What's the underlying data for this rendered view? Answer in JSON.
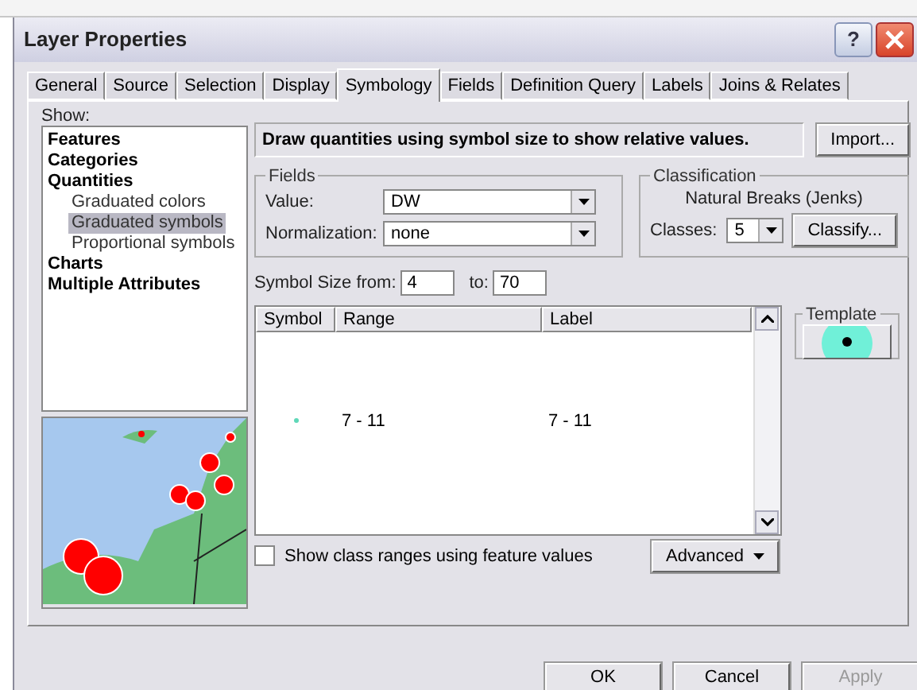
{
  "window": {
    "title": "Layer Properties",
    "help": "?"
  },
  "tabs": [
    {
      "label": "General",
      "selected": false
    },
    {
      "label": "Source",
      "selected": false
    },
    {
      "label": "Selection",
      "selected": false
    },
    {
      "label": "Display",
      "selected": false
    },
    {
      "label": "Symbology",
      "selected": true
    },
    {
      "label": "Fields",
      "selected": false
    },
    {
      "label": "Definition Query",
      "selected": false
    },
    {
      "label": "Labels",
      "selected": false
    },
    {
      "label": "Joins & Relates",
      "selected": false
    }
  ],
  "show": {
    "label": "Show:",
    "items": [
      {
        "label": "Features",
        "selected": false
      },
      {
        "label": "Categories",
        "selected": false
      },
      {
        "label": "Quantities",
        "selected": false,
        "children": [
          {
            "label": "Graduated colors",
            "selected": false
          },
          {
            "label": "Graduated symbols",
            "selected": true
          },
          {
            "label": "Proportional symbols",
            "selected": false
          }
        ]
      },
      {
        "label": "Charts",
        "selected": false
      },
      {
        "label": "Multiple Attributes",
        "selected": false
      }
    ]
  },
  "description": "Draw quantities using symbol size to show relative values.",
  "import_button": "Import...",
  "fields": {
    "title": "Fields",
    "value_label": "Value:",
    "value": "DW",
    "normalization_label": "Normalization:",
    "normalization": "none"
  },
  "classification": {
    "title": "Classification",
    "method": "Natural Breaks (Jenks)",
    "classes_label": "Classes:",
    "classes": "5",
    "classify_button": "Classify..."
  },
  "symbol_size": {
    "from_label": "Symbol Size from:",
    "from": "4",
    "to_label": "to:",
    "to": "70"
  },
  "table": {
    "columns": [
      "Symbol",
      "Range",
      "Label"
    ],
    "rows": [
      {
        "range": "7 - 11",
        "label": "7 - 11"
      }
    ]
  },
  "template": {
    "title": "Template"
  },
  "range_checkbox": {
    "label": "Show class ranges using feature values",
    "checked": false
  },
  "advanced_button": "Advanced",
  "buttons": [
    {
      "label": "OK",
      "disabled": false
    },
    {
      "label": "Cancel",
      "disabled": false
    },
    {
      "label": "Apply",
      "disabled": true
    }
  ]
}
